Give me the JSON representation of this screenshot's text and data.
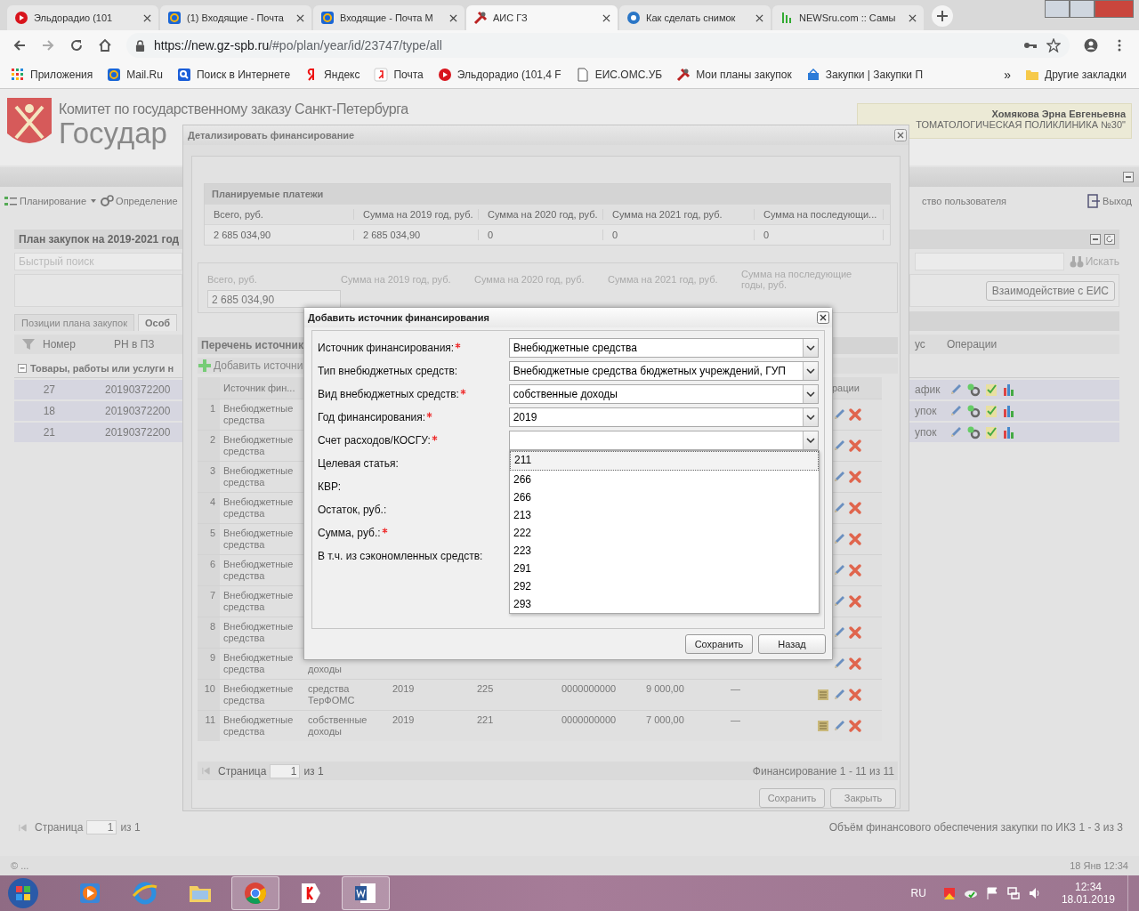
{
  "browser": {
    "tabs": [
      {
        "title": "Эльдорадио (101",
        "kind": "radio",
        "selected": false
      },
      {
        "title": "(1) Входящие - Почта",
        "kind": "mail",
        "selected": false
      },
      {
        "title": "Входящие - Почта М",
        "kind": "mail",
        "selected": false
      },
      {
        "title": "АИС ГЗ",
        "kind": "tools",
        "selected": true
      },
      {
        "title": "Как сделать снимок",
        "kind": "help",
        "selected": false
      },
      {
        "title": "NEWSru.com :: Самы",
        "kind": "news",
        "selected": false
      }
    ],
    "url": {
      "host": "https://new.gz-spb.ru",
      "path": "/#po/plan/year/id/23747/type/all"
    },
    "bookmarks": [
      {
        "label": "Приложения",
        "kind": "apps"
      },
      {
        "label": "Mail.Ru",
        "kind": "mail"
      },
      {
        "label": "Поиск в Интернете",
        "kind": "search"
      },
      {
        "label": "Яндекс",
        "kind": "yandex"
      },
      {
        "label": "Почта",
        "kind": "yandex-mail"
      },
      {
        "label": "Эльдорадио (101,4 F",
        "kind": "radio"
      },
      {
        "label": "ЕИС.ОМС.УБ",
        "kind": "page"
      },
      {
        "label": "Мои планы закупок",
        "kind": "tools"
      },
      {
        "label": "Закупки | Закупки П",
        "kind": "cart"
      }
    ],
    "more": "»",
    "other_bookmarks": "Другие закладки"
  },
  "page": {
    "header": {
      "committee": "Комитет по государственному заказу Санкт-Петербурга",
      "system": "Государ",
      "user": "Хомякова Эрна Евгеньевна",
      "organization": "ТОМАТОЛОГИЧЕСКАЯ ПОЛИКЛИНИКА №30\""
    },
    "menu_left": [
      {
        "label": "Планирование",
        "dropdown": true
      },
      {
        "label": "Определение",
        "dropdown": false
      }
    ],
    "menu_right": [
      "ство пользователя",
      "Выход"
    ],
    "plan": {
      "title": "План закупок на 2019-2021 год",
      "search_placeholder": "Быстрый поиск",
      "search_button": "Искать",
      "eis_button": "Взаимодействие с ЕИС",
      "tabs": [
        {
          "label": "Позиции плана закупок",
          "selected": false
        },
        {
          "label": "Особ",
          "selected": true
        }
      ],
      "columns_left": [
        "Номер",
        "РН в ПЗ"
      ],
      "columns_right": [
        "ус",
        "Операции"
      ],
      "group": "Товары, работы или услуги н",
      "rows": [
        {
          "number": "27",
          "rn": "20190372200",
          "status": "афик"
        },
        {
          "number": "18",
          "rn": "20190372200",
          "status": "упок"
        },
        {
          "number": "21",
          "rn": "20190372200",
          "status": "упок"
        }
      ],
      "pager": {
        "label": "Страница",
        "page": "1",
        "of": "из 1",
        "summary": "Объём финансового обеспечения закупки по ИКЗ 1 - 3 из 3"
      }
    },
    "footer": {
      "copyright": "© ...",
      "datetime": "18 Янв 12:34"
    }
  },
  "details_dialog": {
    "title": "Детализировать финансирование",
    "planned": {
      "title": "Планируемые платежи",
      "columns": [
        "Всего, руб.",
        "Сумма на 2019 год, руб.",
        "Сумма на 2020 год, руб.",
        "Сумма на 2021 год, руб.",
        "Сумма на последующи..."
      ],
      "values": [
        "2 685 034,90",
        "2 685 034,90",
        "0",
        "0",
        "0"
      ]
    },
    "totals": {
      "labels": [
        "Всего, руб.",
        "Сумма на 2019 год, руб.",
        "Сумма на 2020 год, руб.",
        "Сумма на 2021 год, руб.",
        "Сумма на последующие годы, руб."
      ],
      "first_value": "2 685 034,90"
    },
    "sources": {
      "title": "Перечень источник",
      "add": "Добавить источни",
      "source_header": "Источник фин...",
      "operations_header": "рации",
      "rows": [
        {
          "n": "1",
          "source": "Внебюджетные средства"
        },
        {
          "n": "2",
          "source": "Внебюджетные средства"
        },
        {
          "n": "3",
          "source": "Внебюджетные средства"
        },
        {
          "n": "4",
          "source": "Внебюджетные средства"
        },
        {
          "n": "5",
          "source": "Внебюджетные средства"
        },
        {
          "n": "6",
          "source": "Внебюджетные средства"
        },
        {
          "n": "7",
          "source": "Внебюджетные средства"
        },
        {
          "n": "8",
          "source": "Внебюджетные средства"
        },
        {
          "n": "9",
          "source": "Внебюджетные средства",
          "type_tail": "доходы"
        },
        {
          "n": "10",
          "source": "Внебюджетные средства",
          "type": "средства ТерФОМС",
          "year": "2019",
          "kosgu": "225",
          "article": "0000000000",
          "sum": "9 000,00",
          "saved": "—",
          "document": true
        },
        {
          "n": "11",
          "source": "Внебюджетные средства",
          "type": "собственные доходы",
          "year": "2019",
          "kosgu": "221",
          "article": "0000000000",
          "sum": "7 000,00",
          "saved": "—",
          "document": true
        }
      ]
    },
    "pager": {
      "label": "Страница",
      "page": "1",
      "of": "из 1",
      "summary": "Финансирование 1 - 11 из 11"
    },
    "buttons": [
      "Сохранить",
      "Закрыть"
    ]
  },
  "add_dialog": {
    "title": "Добавить источник финансирования",
    "fields": [
      {
        "label": "Источник финансирования:",
        "required": true,
        "kind": "select",
        "value": "Внебюджетные средства"
      },
      {
        "label": "Тип внебюджетных средств:",
        "required": false,
        "kind": "select",
        "value": "Внебюджетные средства бюджетных учреждений, ГУП"
      },
      {
        "label": "Вид внебюджетных средств:",
        "required": true,
        "kind": "select",
        "value": "собственные доходы"
      },
      {
        "label": "Год финансирования:",
        "required": true,
        "kind": "select",
        "value": "2019"
      },
      {
        "label": "Счет расходов/КОСГУ:",
        "required": true,
        "kind": "select"
      },
      {
        "label": "Целевая статья:",
        "required": false,
        "kind": "label"
      },
      {
        "label": "КВР:",
        "required": false,
        "kind": "label"
      },
      {
        "label": "Остаток, руб.:",
        "required": false,
        "kind": "label"
      },
      {
        "label": "Сумма, руб.:",
        "required": true,
        "kind": "label"
      },
      {
        "label": "В т.ч. из сэкономленных средств:",
        "required": false,
        "kind": "label"
      }
    ],
    "options": [
      {
        "label": "211",
        "selected": true
      },
      {
        "label": "266",
        "selected": false
      },
      {
        "label": "266",
        "selected": false
      },
      {
        "label": "213",
        "selected": false
      },
      {
        "label": "222",
        "selected": false
      },
      {
        "label": "223",
        "selected": false
      },
      {
        "label": "291",
        "selected": false
      },
      {
        "label": "292",
        "selected": false
      },
      {
        "label": "293",
        "selected": false
      }
    ],
    "buttons": [
      "Сохранить",
      "Назад"
    ]
  },
  "taskbar": {
    "apps": [
      {
        "kind": "media",
        "active": false
      },
      {
        "kind": "ie",
        "active": false
      },
      {
        "kind": "explorer",
        "active": false
      },
      {
        "kind": "chrome",
        "active": true
      },
      {
        "kind": "yandex",
        "active": false
      },
      {
        "kind": "word",
        "active": true
      }
    ],
    "language": "RU",
    "time": "12:34",
    "date": "18.01.2019"
  }
}
